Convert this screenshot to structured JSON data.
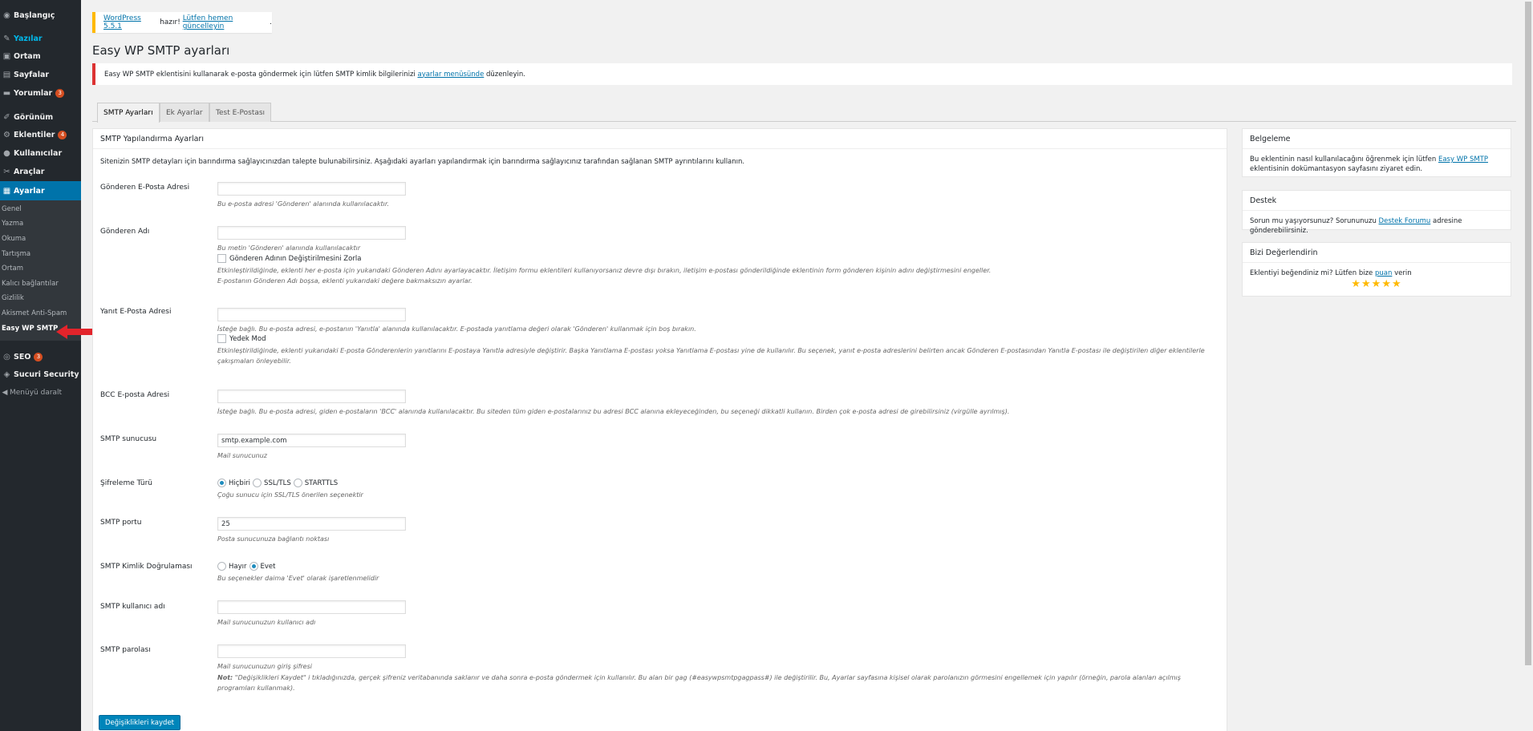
{
  "sidebar": {
    "items": [
      {
        "label": "Başlangıç",
        "icon": "dashboard-icon",
        "glyph": "◉"
      },
      {
        "label": "Yazılar",
        "icon": "pin-icon",
        "glyph": "✎"
      },
      {
        "label": "Ortam",
        "icon": "media-icon",
        "glyph": "▣"
      },
      {
        "label": "Sayfalar",
        "icon": "pages-icon",
        "glyph": "▤"
      },
      {
        "label": "Yorumlar",
        "icon": "comments-icon",
        "glyph": "▬",
        "badge": "3"
      },
      {
        "label": "Görünüm",
        "icon": "appearance-icon",
        "glyph": "✐"
      },
      {
        "label": "Eklentiler",
        "icon": "plugins-icon",
        "glyph": "⚙",
        "badge": "4"
      },
      {
        "label": "Kullanıcılar",
        "icon": "users-icon",
        "glyph": "●"
      },
      {
        "label": "Araçlar",
        "icon": "tools-icon",
        "glyph": "✂"
      },
      {
        "label": "Ayarlar",
        "icon": "settings-icon",
        "glyph": "▦"
      },
      {
        "label": "SEO",
        "icon": "seo-icon",
        "glyph": "◎",
        "badge": "3"
      },
      {
        "label": "Sucuri Security",
        "icon": "shield-icon",
        "glyph": "◈"
      }
    ],
    "submenu": [
      "Genel",
      "Yazma",
      "Okuma",
      "Tartışma",
      "Ortam",
      "Kalıcı bağlantılar",
      "Gizlilik",
      "Akismet Anti-Spam",
      "Easy WP SMTP"
    ],
    "collapse_label": "Menüyü daralt"
  },
  "update_notice": {
    "link1": "WordPress 5.5.1",
    "mid": " hazır! ",
    "link2": "Lütfen hemen güncelleyin",
    "end": "."
  },
  "page_title": "Easy WP SMTP ayarları",
  "error_notice": {
    "before": "Easy WP SMTP eklentisini kullanarak e-posta göndermek için lütfen SMTP kimlik bilgilerinizi ",
    "link": "ayarlar menüsünde",
    "after": " düzenleyin."
  },
  "tabs": [
    "SMTP Ayarları",
    "Ek Ayarlar",
    "Test E-Postası"
  ],
  "main": {
    "header": "SMTP Yapılandırma Ayarları",
    "intro": "Sitenizin SMTP detayları için barındırma sağlayıcınızdan talepte bulunabilirsiniz. Aşağıdaki ayarları yapılandırmak için barındırma sağlayıcınız tarafından sağlanan SMTP ayrıntılarını kullanın.",
    "from_email": {
      "label": "Gönderen E-Posta Adresi",
      "value": "",
      "desc": "Bu e-posta adresi 'Gönderen' alanında kullanılacaktır."
    },
    "from_name": {
      "label": "Gönderen Adı",
      "value": "",
      "desc": "Bu metin 'Gönderen' alanında kullanılacaktır",
      "force_label": "Gönderen Adının Değiştirilmesini Zorla",
      "force_desc1": "Etkinleştirildiğinde, eklenti her e-posta için yukarıdaki Gönderen Adını ayarlayacaktır. İletişim formu eklentileri kullanıyorsanız devre dışı bırakın, iletişim e-postası gönderildiğinde eklentinin form gönderen kişinin adını değiştirmesini engeller.",
      "force_desc2": "E-postanın Gönderen Adı boşsa, eklenti yukarıdaki değere bakmaksızın ayarlar."
    },
    "reply_to": {
      "label": "Yanıt E-Posta Adresi",
      "value": "",
      "desc": "İsteğe bağlı. Bu e-posta adresi, e-postanın 'Yanıtla' alanında kullanılacaktır. E-postada yanıtlama değeri olarak 'Gönderen' kullanmak için boş bırakın.",
      "sub_label": "Yedek Mod",
      "sub_desc1": "Etkinleştirildiğinde, eklenti yukarıdaki E-posta Gönderenlerin yanıtlarını E-postaya Yanıtla adresiyle değiştirir. Başka Yanıtlama E-postası yoksa Yanıtlama E-postası yine de kullanılır. Bu seçenek, yanıt e-posta adreslerini belirten ancak Gönderen E-postasından Yanıtla E-postası ile değiştirilen diğer eklentilerle",
      "sub_desc2": "çakışmaları önleyebilir."
    },
    "bcc": {
      "label": "BCC E-posta Adresi",
      "value": "",
      "desc": "İsteğe bağlı. Bu e-posta adresi, giden e-postaların 'BCC' alanında kullanılacaktır. Bu siteden tüm giden e-postalarınız bu adresi BCC alanına ekleyeceğinden, bu seçeneği dikkatli kullanın. Birden çok e-posta adresi de girebilirsiniz (virgülle ayrılmış)."
    },
    "smtp_host": {
      "label": "SMTP sunucusu",
      "value": "smtp.example.com",
      "desc": "Mail sunucunuz"
    },
    "encryption": {
      "label": "Şifreleme Türü",
      "options": [
        "Hiçbiri",
        "SSL/TLS",
        "STARTTLS"
      ],
      "selected": "Hiçbiri",
      "desc": "Çoğu sunucu için SSL/TLS önerilen seçenektir"
    },
    "smtp_port": {
      "label": "SMTP portu",
      "value": "25",
      "desc": "Posta sunucunuza bağlantı noktası"
    },
    "smtp_auth": {
      "label": "SMTP Kimlik Doğrulaması",
      "options": [
        "Hayır",
        "Evet"
      ],
      "selected": "Evet",
      "desc": "Bu seçenekler daima 'Evet' olarak işaretlenmelidir"
    },
    "smtp_user": {
      "label": "SMTP kullanıcı adı",
      "value": "",
      "desc": "Mail sunucunuzun kullanıcı adı"
    },
    "smtp_pass": {
      "label": "SMTP parolası",
      "value": "",
      "desc": "Mail sunucunuzun giriş şifresi",
      "note_bold": "Not:",
      "note1": " \"Değişiklikleri Kaydet\" i tıkladığınızda, gerçek şifreniz veritabanında saklanır ve daha sonra e-posta göndermek için kullanılır. Bu alan bir gag (#easywpsmtpgagpass#) ile değiştirilir. Bu, Ayarlar sayfasına kişisel olarak parolanızın görmesini engellemek için yapılır (örneğin, parola alanları açılmış",
      "note2": "programları kullanmak)."
    },
    "save_label": "Değişiklikleri kaydet"
  },
  "side": {
    "docs": {
      "title": "Belgeleme",
      "before": "Bu eklentinin nasıl kullanılacağını öğrenmek için lütfen ",
      "link": "Easy WP SMTP",
      "after": " eklentisinin dokümantasyon sayfasını ziyaret edin."
    },
    "support": {
      "title": "Destek",
      "before": "Sorun mu yaşıyorsunuz? Sorununuzu ",
      "link": "Destek Forumu",
      "after": " adresine gönderebilirsiniz."
    },
    "rate": {
      "title": "Bizi Değerlendirin",
      "before": "Eklentiyi beğendiniz mi? Lütfen bize ",
      "link": "puan",
      "after": " verin",
      "stars": "★★★★★",
      "rating": 5
    }
  }
}
